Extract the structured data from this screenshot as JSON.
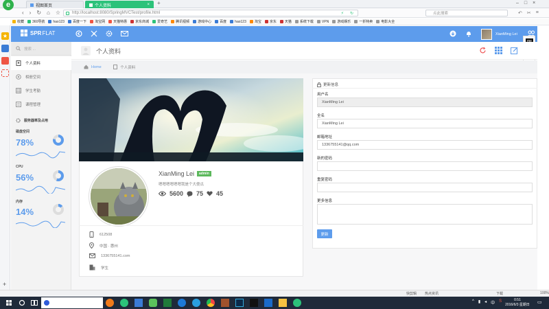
{
  "browser": {
    "tabs": [
      {
        "label": "视图首页"
      },
      {
        "label": "个人资料"
      }
    ],
    "new_tab": "+",
    "address": "http://localhost:8080/SpringMVCTest/profile.html",
    "search_placeholder": "点此搜索",
    "window_controls": [
      "–",
      "□",
      "×"
    ],
    "favorites": [
      "收藏",
      "360导航",
      "hao123",
      "百度一下",
      "淘宝网",
      "天猫特惠",
      "京东商城",
      "爱奇艺",
      "腾讯视频",
      "游戏中心",
      "百度",
      "hao123",
      "淘宝",
      "京东",
      "天猫",
      "系统下载",
      "VPN",
      "游戏娱乐",
      "一折特卖",
      "电影大全"
    ]
  },
  "app": {
    "brand_left": "SPR",
    "brand_right": "FLAT",
    "user_name": "XianMing Lei",
    "search_placeholder": "搜索 ..."
  },
  "sidebar": {
    "items": [
      {
        "label": "个人资料",
        "icon": "user-icon",
        "active": true
      },
      {
        "label": "相册空间",
        "icon": "album-icon",
        "active": false
      },
      {
        "label": "学生考勤",
        "icon": "grid-icon",
        "active": false
      },
      {
        "label": "课程管理",
        "icon": "list-icon",
        "active": false
      }
    ],
    "section_title": "服务器率及占用",
    "stats": [
      {
        "label": "磁盘空间",
        "value": "78%",
        "pct": 78
      },
      {
        "label": "CPU",
        "value": "56%",
        "pct": 56
      },
      {
        "label": "内存",
        "value": "14%",
        "pct": 14
      }
    ]
  },
  "page": {
    "title": "个人资料",
    "breadcrumb": {
      "home": "Home",
      "current": "个人资料"
    }
  },
  "profile": {
    "name": "XianMing Lei",
    "badge": "admin",
    "motto": "嗯嗯嗯嗯嗯嗯我是个大傻瓜",
    "views": "5600",
    "comments": "75",
    "likes": "45",
    "info": [
      {
        "icon": "phone-icon",
        "text": "612508"
      },
      {
        "icon": "location-icon",
        "text": "中国 · 惠州"
      },
      {
        "icon": "mail-icon",
        "text": "1336755141.com"
      },
      {
        "icon": "building-icon",
        "text": "学生"
      }
    ]
  },
  "form": {
    "title": "更新信息",
    "username_label": "用户名",
    "username_value": "XianMing Lei",
    "fullname_label": "全名",
    "fullname_value": "XianMing Lei",
    "email_label": "邮箱地址",
    "email_value": "1336755141@qq.com",
    "new_password_label": "新的密码",
    "repeat_password_label": "重复密码",
    "more_label": "更多信息",
    "submit": "更新"
  },
  "statusbar": {
    "items": [
      "快剪辑",
      "热点资讯",
      "下载",
      "100%"
    ]
  },
  "taskbar": {
    "time": "0:51",
    "date": "2016/6/3 星期日",
    "lang": "中",
    "search": ""
  },
  "colors": {
    "accent": "#5d9cec",
    "badge": "#5cb85c",
    "taskbar": "#1f2a3a"
  }
}
